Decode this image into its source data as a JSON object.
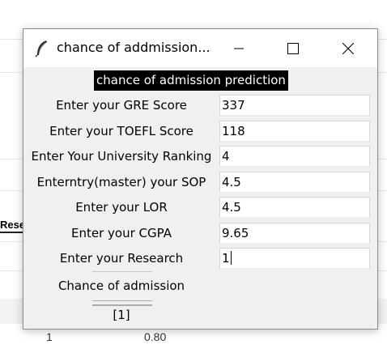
{
  "background": {
    "header_fragment": "Rese",
    "row_values": [
      "1",
      "0.80"
    ]
  },
  "window": {
    "title": "chance of addmission...",
    "controls": {
      "minimize": "minimize-icon",
      "maximize": "maximize-icon",
      "close": "close-icon"
    }
  },
  "form": {
    "heading": "chance of admission prediction",
    "fields": [
      {
        "label": "Enter your GRE Score",
        "value": "337"
      },
      {
        "label": "Enter your TOEFL Score",
        "value": "118"
      },
      {
        "label": "Enter Your University Ranking",
        "value": "4"
      },
      {
        "label": "Enterntry(master) your SOP",
        "value": "4.5"
      },
      {
        "label": "Enter your LOR",
        "value": "4.5"
      },
      {
        "label": "Enter your CGPA",
        "value": "9.65"
      },
      {
        "label": "Enter your Research",
        "value": "1"
      }
    ],
    "button_label": "Chance of admission",
    "result": "[1]"
  },
  "colors": {
    "heading_bg": "#000000",
    "heading_fg": "#ffffff",
    "window_bg": "#f0f0f0"
  }
}
